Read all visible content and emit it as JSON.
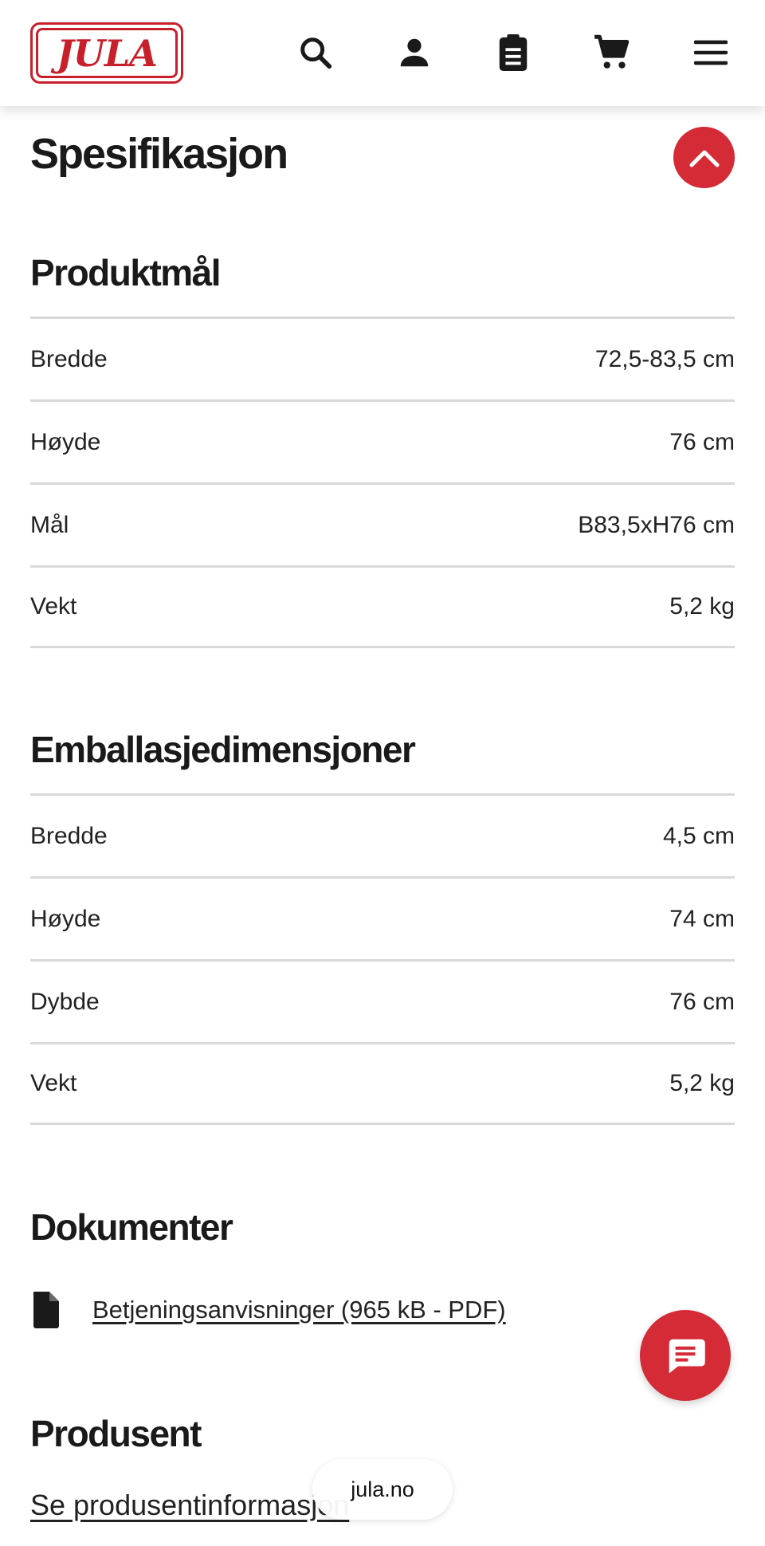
{
  "header": {
    "logo_text": "JULA",
    "icons": [
      "search-icon",
      "account-icon",
      "clipboard-icon",
      "cart-icon",
      "menu-icon"
    ]
  },
  "page": {
    "title": "Spesifikasjon"
  },
  "product_dimensions": {
    "heading": "Produktmål",
    "rows": [
      {
        "label": "Bredde",
        "value": "72,5-83,5 cm"
      },
      {
        "label": "Høyde",
        "value": "76 cm"
      },
      {
        "label": "Mål",
        "value": "B83,5xH76 cm"
      },
      {
        "label": "Vekt",
        "value": "5,2 kg"
      }
    ]
  },
  "package_dimensions": {
    "heading": "Emballasjedimensjoner",
    "rows": [
      {
        "label": "Bredde",
        "value": "4,5 cm"
      },
      {
        "label": "Høyde",
        "value": "74 cm"
      },
      {
        "label": "Dybde",
        "value": "76 cm"
      },
      {
        "label": "Vekt",
        "value": "5,2 kg"
      }
    ]
  },
  "documents": {
    "heading": "Dokumenter",
    "link_label": "Betjeningsanvisninger (965 kB - PDF)"
  },
  "producer": {
    "heading": "Produsent",
    "link_label": "Se produsentinformasjon"
  },
  "browser": {
    "url": "jula.no"
  },
  "colors": {
    "brand_red": "#d42b37",
    "divider": "#d9d9d9"
  }
}
